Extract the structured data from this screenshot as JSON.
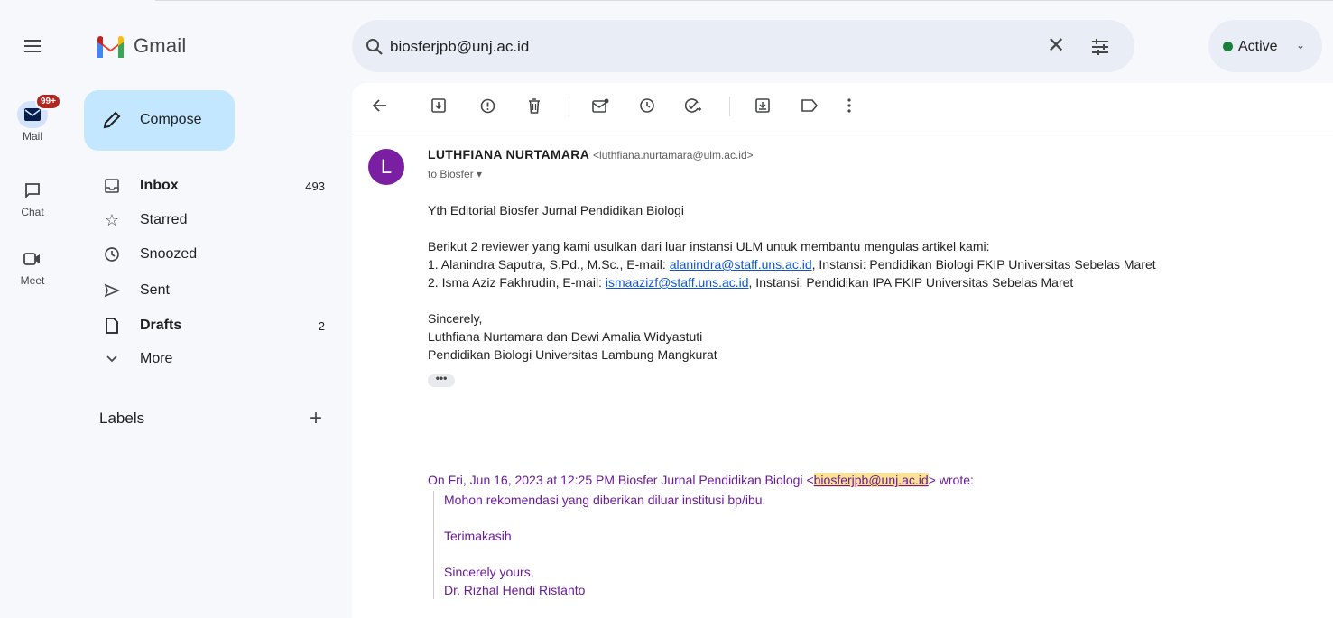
{
  "app": {
    "name": "Gmail"
  },
  "search": {
    "value": "biosferjpb@unj.ac.id",
    "clear_icon": "close-icon",
    "filter_icon": "tune-icon"
  },
  "status": {
    "label": "Active",
    "color": "#188038"
  },
  "rail": {
    "mail": {
      "label": "Mail",
      "badge": "99+"
    },
    "chat": {
      "label": "Chat"
    },
    "meet": {
      "label": "Meet"
    }
  },
  "compose": {
    "label": "Compose"
  },
  "nav": [
    {
      "label": "Inbox",
      "count": "493",
      "icon": "inbox-icon",
      "bold": true
    },
    {
      "label": "Starred",
      "count": "",
      "icon": "star-icon",
      "bold": false
    },
    {
      "label": "Snoozed",
      "count": "",
      "icon": "clock-icon",
      "bold": false
    },
    {
      "label": "Sent",
      "count": "",
      "icon": "send-icon",
      "bold": false
    },
    {
      "label": "Drafts",
      "count": "2",
      "icon": "draft-icon",
      "bold": true
    },
    {
      "label": "More",
      "count": "",
      "icon": "chevron-down-icon",
      "bold": false
    }
  ],
  "labels": {
    "title": "Labels"
  },
  "message": {
    "avatar_letter": "L",
    "avatar_color": "#7b1fa2",
    "sender_name": "LUTHFIANA NURTAMARA",
    "sender_email": "<luthfiana.nurtamara@ulm.ac.id>",
    "to": "to Biosfer",
    "greeting": "Yth Editorial Biosfer Jurnal Pendidikan Biologi",
    "intro": "Berikut 2 reviewer yang kami usulkan dari luar instansi ULM untuk membantu mengulas artikel kami:",
    "reviewer1_prefix": "1. Alanindra Saputra, S.Pd., M.Sc., E-mail: ",
    "reviewer1_email": "alanindra@staff.uns.ac.id",
    "reviewer1_suffix": ", Instansi: Pendidikan Biologi FKIP Universitas Sebelas Maret",
    "reviewer2_prefix": "2. Isma Aziz Fakhrudin, E-mail: ",
    "reviewer2_email": "ismaazizf@staff.uns.ac.id",
    "reviewer2_suffix": ", Instansi: Pendidikan IPA FKIP Universitas Sebelas Maret",
    "closing": "Sincerely,",
    "sig1": "Luthfiana Nurtamara dan Dewi Amalia Widyastuti",
    "sig2": "Pendidikan Biologi Universitas Lambung Mangkurat",
    "trimmed": "•••"
  },
  "quoted": {
    "header_prefix": "On Fri, Jun 16, 2023 at 12:25 PM Biosfer Jurnal Pendidikan Biologi <",
    "header_email": "biosferjpb@unj.ac.id",
    "header_suffix": "> wrote:",
    "line1": "Mohon rekomendasi yang diberikan diluar institusi bp/ibu.",
    "line2": "Terimakasih",
    "line3": "Sincerely yours,",
    "line4": "Dr. Rizhal Hendi Ristanto"
  }
}
